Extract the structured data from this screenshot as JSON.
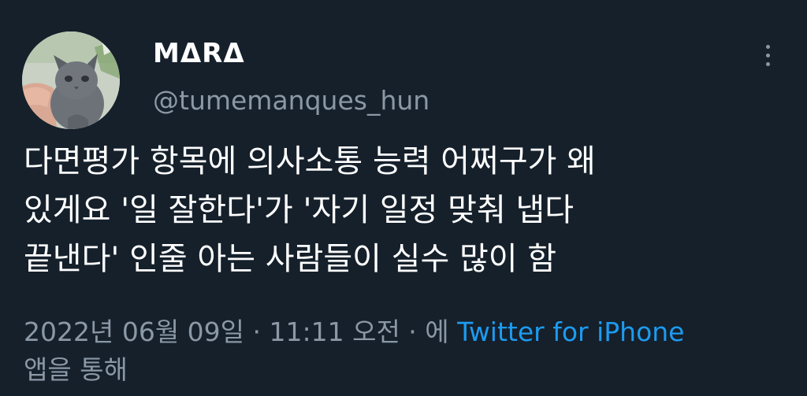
{
  "user": {
    "display_name": "MΔRΔ",
    "handle": "@tumemanques_hun",
    "avatar_icon": "kitten-avatar"
  },
  "tweet": {
    "lines": [
      "다면평가 항목에 의사소통 능력 어쩌구가 왜",
      "있게요 '일 잘한다'가 '자기 일정 맞춰 냅다",
      "끝낸다' 인줄 아는 사람들이 실수 많이 함"
    ]
  },
  "meta": {
    "datetime": "2022년 06월 09일 · 11:11 오전 · 에 ",
    "source": "Twitter for iPhone",
    "via": "앱을 통해"
  },
  "menu": {
    "icon": "more-vertical-icon"
  },
  "colors": {
    "background": "#15202b",
    "secondary_text": "#8b98a5",
    "link": "#1d9bf0"
  }
}
